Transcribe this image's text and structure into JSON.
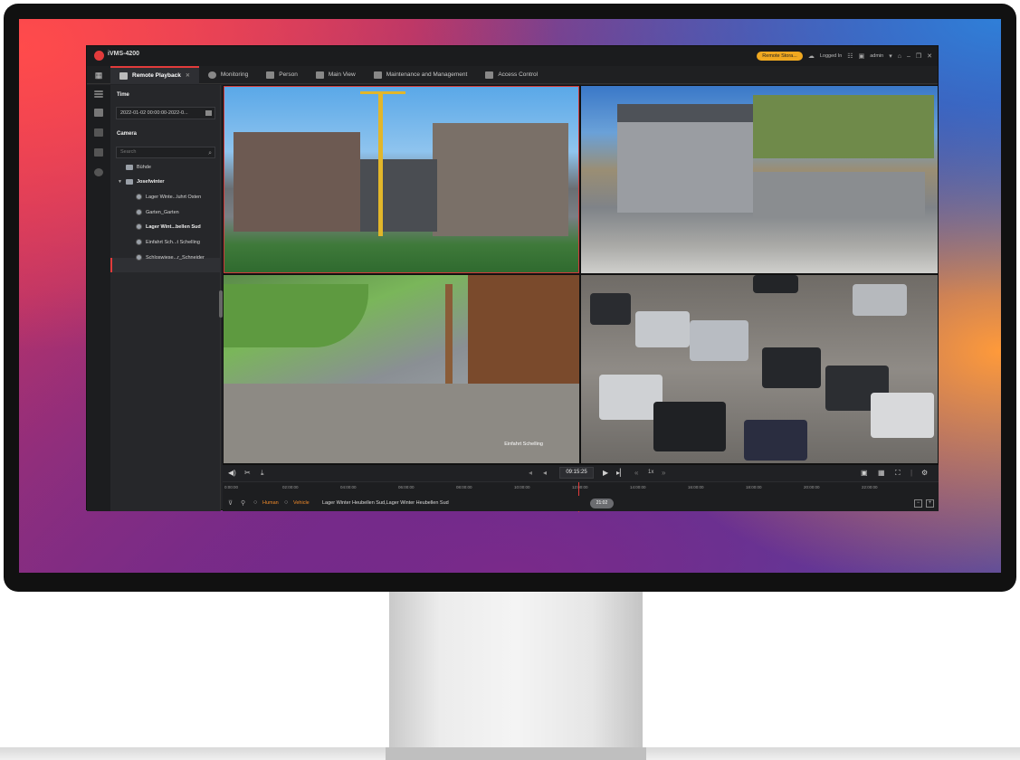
{
  "app": {
    "title": "iVMS-4200",
    "alarm_button": "Remote Stora...",
    "logged_in": "Logged In",
    "user": "admin"
  },
  "tabs": [
    {
      "label": "Remote Playback",
      "active": true
    },
    {
      "label": "Monitoring"
    },
    {
      "label": "Person"
    },
    {
      "label": "Main View"
    },
    {
      "label": "Maintenance and Management"
    },
    {
      "label": "Access Control"
    }
  ],
  "panel": {
    "time_label": "Time",
    "time_value": "2022-01-02 00:00:00-2022-0...",
    "camera_label": "Camera",
    "search_placeholder": "Search",
    "tree": [
      {
        "label": "Bühde",
        "type": "group"
      },
      {
        "label": "Josefwinter",
        "type": "group"
      },
      {
        "label": "Lager Winte...luhrt Osten",
        "type": "camera"
      },
      {
        "label": "Garten_Garten",
        "type": "camera"
      },
      {
        "label": "Lager Wint...bellen Sud",
        "type": "camera",
        "selected": true
      },
      {
        "label": "Einfahrt Sch...t Schelling",
        "type": "camera"
      },
      {
        "label": "Schloswiese...r_Schneider",
        "type": "camera"
      }
    ]
  },
  "video": {
    "caption_3": "Einfahrt Schelling"
  },
  "playback": {
    "current_time": "09:15:25",
    "speed": "1x",
    "ticks": [
      "0:00:00",
      "02:00:00",
      "04:00:00",
      "06:00:00",
      "08:00:00",
      "10:00:00",
      "12:00:00",
      "14:00:00",
      "16:00:00",
      "18:00:00",
      "20:00:00",
      "22:00:00"
    ],
    "time_pill": "21:02"
  },
  "filter": {
    "human": "Human",
    "vehicle": "Vehicle",
    "camera_list": "Lager Winter Heubellen Sud,Lager Winter Heubellen Sud"
  },
  "colors": {
    "accent": "#e23b3b",
    "alarm": "#f0a820",
    "filter": "#f08a2a"
  }
}
